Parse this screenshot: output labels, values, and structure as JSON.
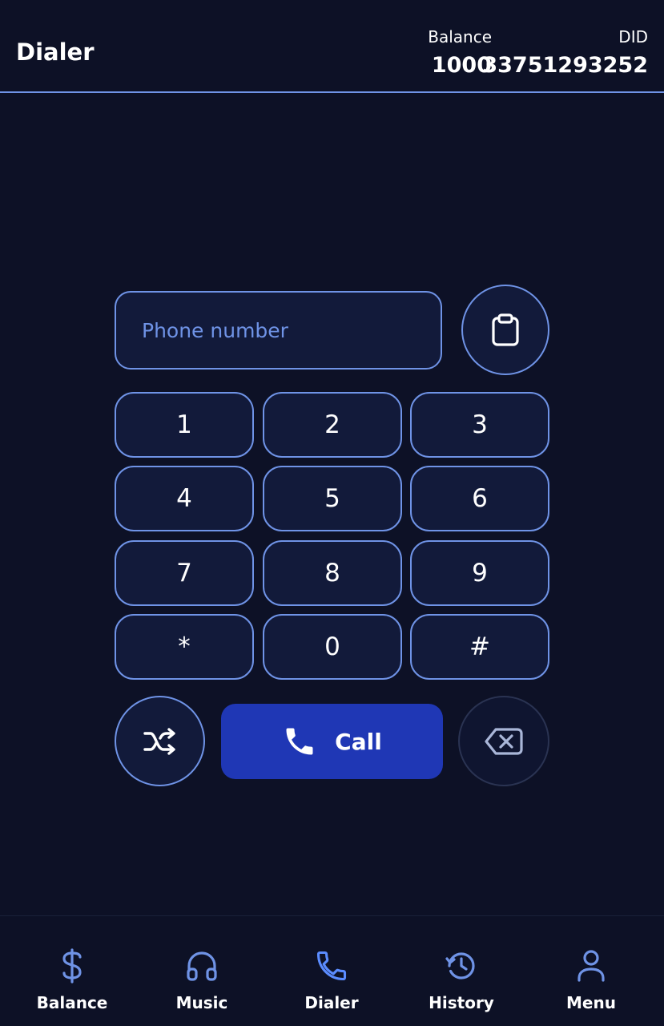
{
  "header": {
    "title": "Dialer",
    "balance_label": "Balance",
    "balance_value": "1000",
    "did_label": "DID",
    "did_value": "33751293252"
  },
  "dialer": {
    "phone_placeholder": "Phone number",
    "phone_value": "",
    "keys": [
      "1",
      "2",
      "3",
      "4",
      "5",
      "6",
      "7",
      "8",
      "9",
      "*",
      "0",
      "#"
    ],
    "call_label": "Call"
  },
  "nav": {
    "items": [
      {
        "label": "Balance",
        "icon": "dollar-icon"
      },
      {
        "label": "Music",
        "icon": "headphones-icon"
      },
      {
        "label": "Dialer",
        "icon": "phone-icon",
        "active": true
      },
      {
        "label": "History",
        "icon": "history-icon"
      },
      {
        "label": "Menu",
        "icon": "user-icon"
      }
    ]
  },
  "colors": {
    "background": "#0d1126",
    "accent": "#6f93e6",
    "call_button": "#1f37b5",
    "key_fill": "#121a3a"
  }
}
